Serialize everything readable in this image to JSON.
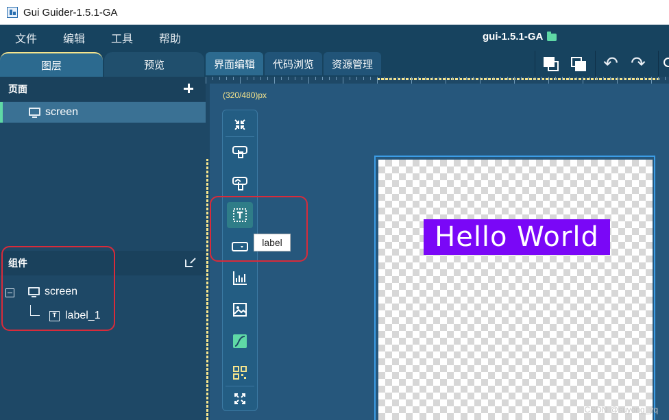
{
  "window": {
    "title": "Gui Guider-1.5.1-GA"
  },
  "menu": {
    "items": [
      "文件",
      "编辑",
      "工具",
      "帮助"
    ],
    "project_name": "gui-1.5.1-GA"
  },
  "left_tabs": {
    "layers": "图层",
    "preview": "预览"
  },
  "pages_section": {
    "title": "页面",
    "pages": [
      {
        "label": "screen"
      }
    ]
  },
  "components_section": {
    "title": "组件",
    "tree": [
      {
        "label": "screen",
        "expanded": true,
        "children": [
          {
            "label": "label_1"
          }
        ]
      }
    ]
  },
  "center_tabs": [
    "界面编辑",
    "代码浏览",
    "资源管理"
  ],
  "toolbar_icons": [
    "copy-icon",
    "paste-icon",
    "undo-icon",
    "redo-icon"
  ],
  "canvas": {
    "resolution": "(320/480)px"
  },
  "widget_bar": {
    "tooltip": "label"
  },
  "screen_preview": {
    "label_text": "Hello World",
    "label_bg": "#7a07f7"
  },
  "watermark": "CSDN @suyong_yq",
  "colors": {
    "accent": "#5fd9a6",
    "highlight": "#f6e58d",
    "annotation": "#d92b3a"
  }
}
